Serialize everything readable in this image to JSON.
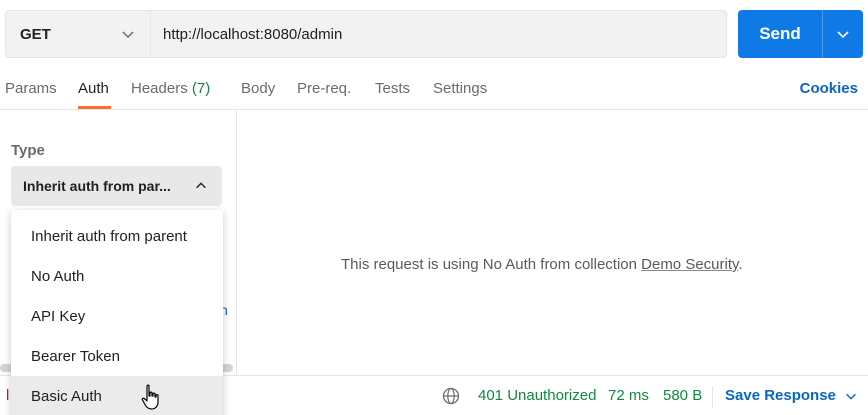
{
  "request": {
    "method": "GET",
    "url": "http://localhost:8080/admin",
    "send_label": "Send"
  },
  "tabs": {
    "params": "Params",
    "auth": "Auth",
    "headers": "Headers",
    "headers_count": "(7)",
    "body": "Body",
    "prereq": "Pre-req.",
    "tests": "Tests",
    "settings": "Settings",
    "cookies": "Cookies",
    "active": "auth"
  },
  "auth": {
    "type_label": "Type",
    "selected": "Inherit auth from par...",
    "partial_link_text": "n",
    "message_prefix": "This request is using No Auth from collection ",
    "collection_name": "Demo Security",
    "message_suffix": "."
  },
  "dropdown": {
    "items": [
      {
        "label": "Inherit auth from parent"
      },
      {
        "label": "No Auth"
      },
      {
        "label": "API Key"
      },
      {
        "label": "Bearer Token"
      },
      {
        "label": "Basic Auth"
      }
    ],
    "hovered_index": 4
  },
  "status": {
    "left_char": "l",
    "code": "401 Unauthorized",
    "time": "72 ms",
    "size": "580 B",
    "save_label": "Save Response"
  },
  "colors": {
    "accent": "#0f7ae5",
    "link": "#0b65c2",
    "tab_underline": "#ff6c37",
    "status_green": "#0f8a3c"
  },
  "icons": {
    "method_chevron": "chevron-down-icon",
    "send_caret": "chevron-down-icon",
    "type_chevron": "chevron-up-icon",
    "globe": "globe-icon",
    "save_chevron": "chevron-down-icon",
    "cursor": "hand-pointer-icon"
  }
}
